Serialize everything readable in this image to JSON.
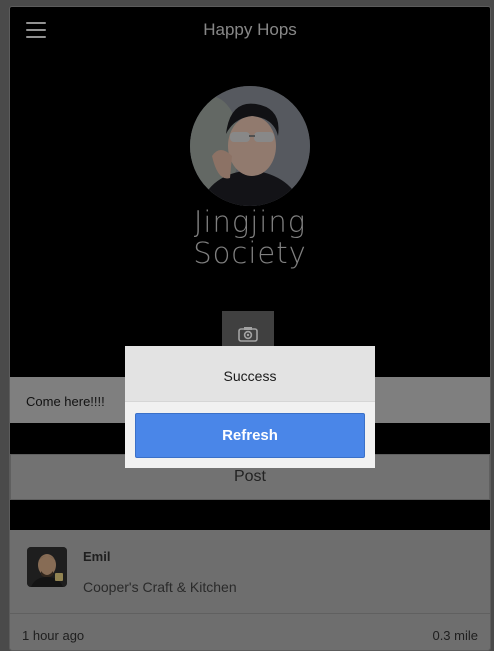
{
  "header": {
    "title": "Happy Hops",
    "menu_icon": "hamburger-menu-icon"
  },
  "profile": {
    "name_line1": "Jingjing",
    "name_line2": "Society",
    "camera_icon": "camera-icon"
  },
  "composer": {
    "input_value": "Come here!!!!",
    "post_label": "Post"
  },
  "feed": [
    {
      "user": "Emil",
      "place": "Cooper's Craft & Kitchen",
      "time": "1 hour ago",
      "distance": "0.3 mile"
    }
  ],
  "dialog": {
    "title": "Success",
    "button_label": "Refresh",
    "button_color": "#4a86e8"
  }
}
